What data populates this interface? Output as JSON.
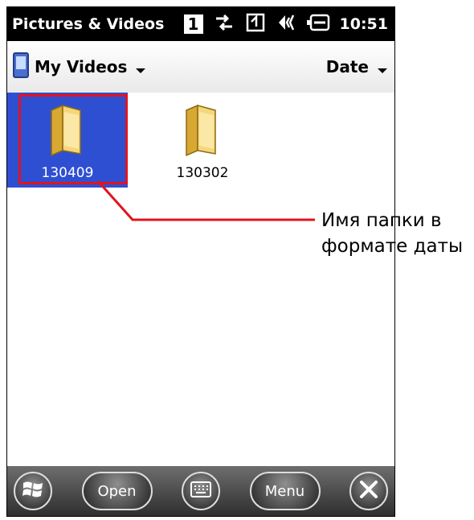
{
  "titlebar": {
    "title": "Pictures & Videos",
    "sim_slot": "1",
    "time": "10:51"
  },
  "navbar": {
    "folder_label": "My Videos",
    "sort_label": "Date"
  },
  "folders": [
    {
      "name": "130409",
      "selected": true
    },
    {
      "name": "130302",
      "selected": false
    }
  ],
  "callout": {
    "line1": "Имя папки в",
    "line2": "формате даты",
    "color": "#e0141d"
  },
  "taskbar": {
    "open_label": "Open",
    "menu_label": "Menu"
  },
  "icons": {
    "start": "windows-start-icon",
    "keyboard": "keyboard-icon",
    "close": "close-icon"
  }
}
